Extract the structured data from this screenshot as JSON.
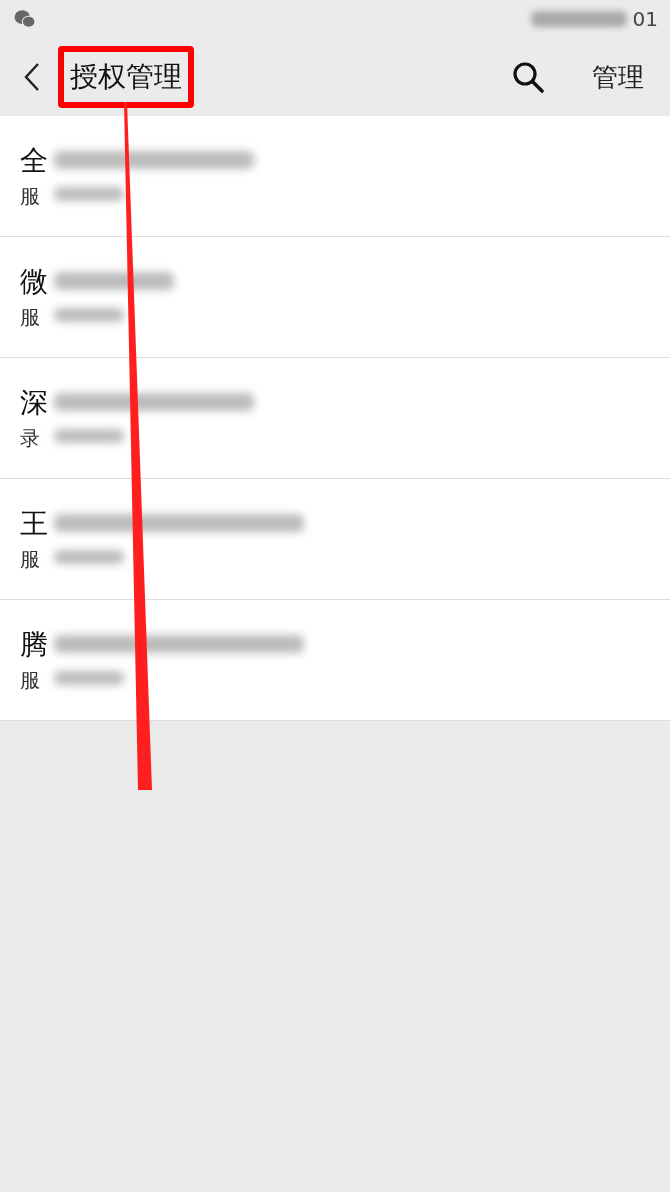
{
  "status_bar": {
    "time": "01"
  },
  "nav": {
    "title": "授权管理",
    "title_highlighted": true,
    "action": "管理"
  },
  "items": [
    {
      "title": "全",
      "subtitle": "服"
    },
    {
      "title": "微",
      "subtitle": "服"
    },
    {
      "title": "深",
      "subtitle": "录"
    },
    {
      "title": "王",
      "subtitle": "服"
    },
    {
      "title": "腾",
      "subtitle": "服"
    }
  ]
}
